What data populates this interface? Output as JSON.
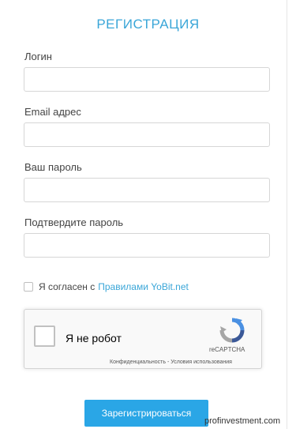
{
  "form": {
    "title": "РЕГИСТРАЦИЯ",
    "fields": [
      {
        "label": "Логин",
        "value": ""
      },
      {
        "label": "Email адрес",
        "value": ""
      },
      {
        "label": "Ваш пароль",
        "value": ""
      },
      {
        "label": "Подтвердите пароль",
        "value": ""
      }
    ],
    "agree_text": "Я согласен с",
    "agree_link": "Правилами YoBit.net",
    "submit_label": "Зарегистрироваться"
  },
  "captcha": {
    "label": "Я не робот",
    "brand": "reCAPTCHA",
    "links": "Конфиденциальность - Условия использования",
    "icon": "recaptcha-logo"
  },
  "watermark": "profinvestment.com",
  "colors": {
    "accent": "#3aa6d8",
    "button": "#2aa6e6"
  }
}
